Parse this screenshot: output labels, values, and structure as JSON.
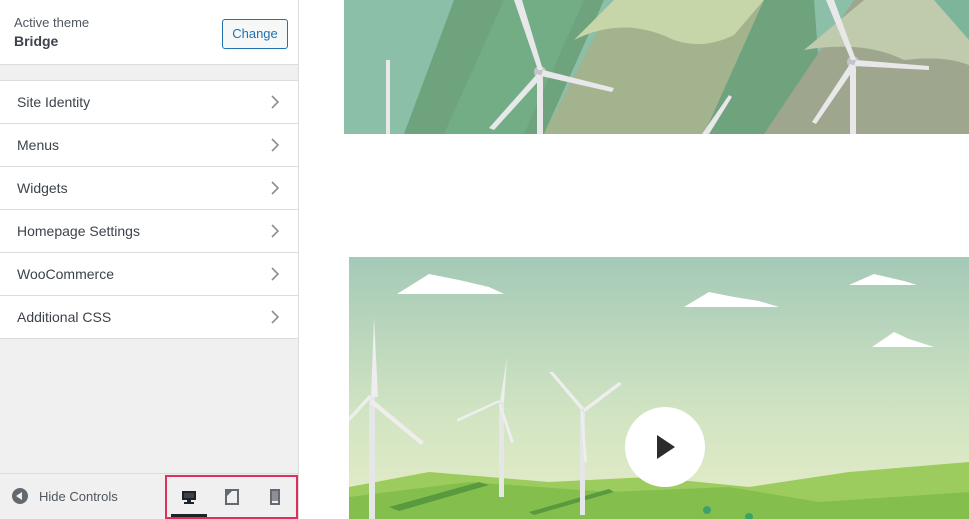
{
  "sidebar": {
    "theme": {
      "label": "Active theme",
      "name": "Bridge",
      "change_label": "Change"
    },
    "menu_items": [
      {
        "label": "Site Identity",
        "icon": "chevron-right-icon"
      },
      {
        "label": "Menus",
        "icon": "chevron-right-icon"
      },
      {
        "label": "Widgets",
        "icon": "chevron-right-icon"
      },
      {
        "label": "Homepage Settings",
        "icon": "chevron-right-icon"
      },
      {
        "label": "WooCommerce",
        "icon": "chevron-right-icon"
      },
      {
        "label": "Additional CSS",
        "icon": "chevron-right-icon"
      }
    ],
    "footer": {
      "hide_controls_label": "Hide Controls",
      "hide_controls_icon": "arrow-left-circle-icon",
      "devices": [
        {
          "name": "desktop",
          "icon": "desktop-icon",
          "active": true
        },
        {
          "name": "tablet",
          "icon": "tablet-icon",
          "active": false
        },
        {
          "name": "mobile",
          "icon": "mobile-icon",
          "active": false
        }
      ],
      "highlight_color": "#e0305a"
    }
  },
  "preview": {
    "banner_image": "wind-turbines-mountains-illustration",
    "video_thumbnail": "wind-turbines-hills-illustration",
    "play_icon": "play-icon"
  },
  "colors": {
    "accent": "#2271b1",
    "text": "#3c434a",
    "sidebar_bg": "#f0f0f1"
  }
}
